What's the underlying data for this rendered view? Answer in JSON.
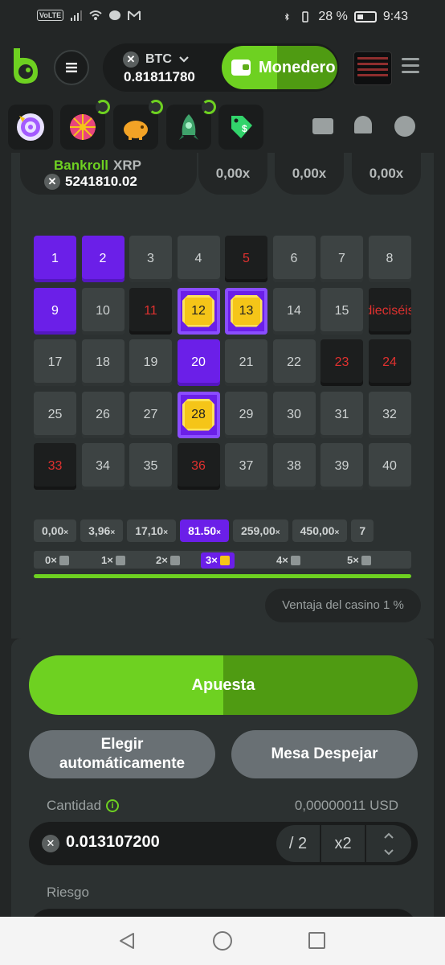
{
  "status_bar": {
    "volte": "VoLTE",
    "battery": "28 %",
    "time": "9:43"
  },
  "header": {
    "currency": "BTC",
    "balance": "0.81811780",
    "wallet_label": "Monedero",
    "accent": "#6ED121"
  },
  "game": {
    "bankroll_label": "Bankroll",
    "bankroll_currency": "XRP",
    "bankroll_value": "5241810.02",
    "multipliers": [
      "0,00x",
      "0,00x",
      "0,00x"
    ],
    "grid": [
      {
        "n": "1",
        "state": "selected"
      },
      {
        "n": "2",
        "state": "selected"
      },
      {
        "n": "3",
        "state": "normal"
      },
      {
        "n": "4",
        "state": "normal"
      },
      {
        "n": "5",
        "state": "miss"
      },
      {
        "n": "6",
        "state": "normal"
      },
      {
        "n": "7",
        "state": "normal"
      },
      {
        "n": "8",
        "state": "normal"
      },
      {
        "n": "9",
        "state": "selected"
      },
      {
        "n": "10",
        "state": "normal"
      },
      {
        "n": "11",
        "state": "miss"
      },
      {
        "n": "12",
        "state": "hit"
      },
      {
        "n": "13",
        "state": "hit"
      },
      {
        "n": "14",
        "state": "normal"
      },
      {
        "n": "15",
        "state": "normal"
      },
      {
        "n": "dieciséis",
        "state": "miss"
      },
      {
        "n": "17",
        "state": "normal"
      },
      {
        "n": "18",
        "state": "normal"
      },
      {
        "n": "19",
        "state": "normal"
      },
      {
        "n": "20",
        "state": "selected"
      },
      {
        "n": "21",
        "state": "normal"
      },
      {
        "n": "22",
        "state": "normal"
      },
      {
        "n": "23",
        "state": "miss"
      },
      {
        "n": "24",
        "state": "miss"
      },
      {
        "n": "25",
        "state": "normal"
      },
      {
        "n": "26",
        "state": "normal"
      },
      {
        "n": "27",
        "state": "normal"
      },
      {
        "n": "28",
        "state": "hit"
      },
      {
        "n": "29",
        "state": "normal"
      },
      {
        "n": "30",
        "state": "normal"
      },
      {
        "n": "31",
        "state": "normal"
      },
      {
        "n": "32",
        "state": "normal"
      },
      {
        "n": "33",
        "state": "miss"
      },
      {
        "n": "34",
        "state": "normal"
      },
      {
        "n": "35",
        "state": "normal"
      },
      {
        "n": "36",
        "state": "miss"
      },
      {
        "n": "37",
        "state": "normal"
      },
      {
        "n": "38",
        "state": "normal"
      },
      {
        "n": "39",
        "state": "normal"
      },
      {
        "n": "40",
        "state": "normal"
      }
    ],
    "payouts": [
      {
        "value": "0,00",
        "active": false
      },
      {
        "value": "3,96",
        "active": false
      },
      {
        "value": "17,10",
        "active": false
      },
      {
        "value": "81.50",
        "active": true
      },
      {
        "value": "259,00",
        "active": false
      },
      {
        "value": "450,00",
        "active": false
      },
      {
        "value": "7",
        "active": false
      }
    ],
    "payout_suffix": "×",
    "hits": [
      {
        "label": "0×",
        "active": false
      },
      {
        "label": "1×",
        "active": false
      },
      {
        "label": "2×",
        "active": false
      },
      {
        "label": "3×",
        "active": true
      },
      {
        "label": "4×",
        "active": false
      },
      {
        "label": "5×",
        "active": false
      }
    ],
    "progress": 1.0,
    "house_edge": "Ventaja del casino 1 %"
  },
  "bet": {
    "bet_label": "Apuesta",
    "auto_label_1": "Elegir",
    "auto_label_2": "automáticamente",
    "clear_label": "Mesa Despejar",
    "amount_label": "Cantidad",
    "usd_value": "0,00000011 USD",
    "amount_value": "0.013107200",
    "half_label": "/ 2",
    "double_label": "x2",
    "risk_label": "Riesgo"
  }
}
